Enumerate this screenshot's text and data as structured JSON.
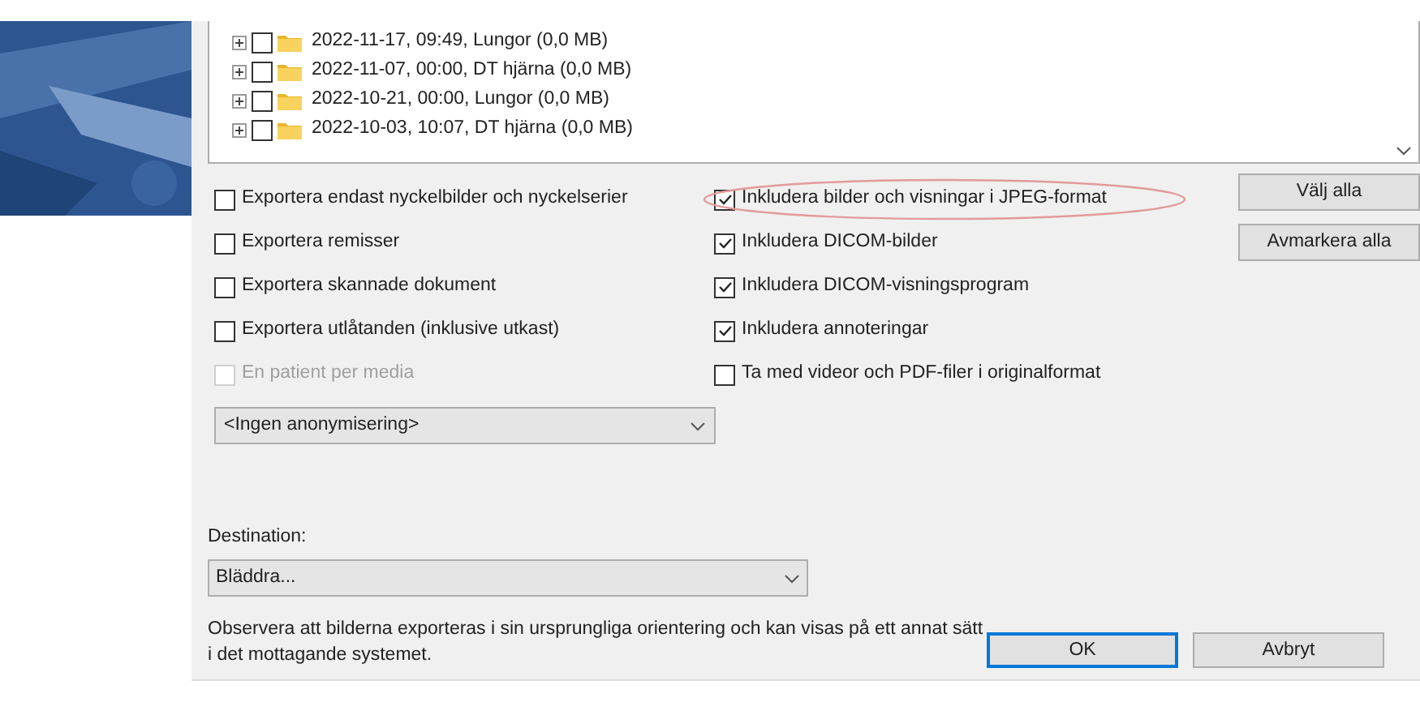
{
  "tree": {
    "rows": [
      {
        "label": "2022-11-17, 09:49, Lungor (0,0 MB)",
        "checked": false,
        "expanded": false
      },
      {
        "label": "2022-11-07, 00:00, DT hjärna (0,0 MB)",
        "checked": false,
        "expanded": false
      },
      {
        "label": "2022-10-21, 00:00, Lungor (0,0 MB)",
        "checked": false,
        "expanded": false
      },
      {
        "label": "2022-10-03, 10:07, DT hjärna (0,0 MB)",
        "checked": false,
        "expanded": false
      }
    ]
  },
  "left_options": [
    {
      "label": "Exportera endast nyckelbilder och nyckelserier",
      "checked": false,
      "disabled": false
    },
    {
      "label": "Exportera remisser",
      "checked": false,
      "disabled": false
    },
    {
      "label": "Exportera skannade dokument",
      "checked": false,
      "disabled": false
    },
    {
      "label": "Exportera utlåtanden (inklusive utkast)",
      "checked": false,
      "disabled": false
    },
    {
      "label": "En patient per media",
      "checked": false,
      "disabled": true
    }
  ],
  "right_options": [
    {
      "label": "Inkludera bilder och visningar i JPEG-format",
      "checked": true,
      "circled": true
    },
    {
      "label": "Inkludera DICOM-bilder",
      "checked": true,
      "circled": false
    },
    {
      "label": "Inkludera DICOM-visningsprogram",
      "checked": true,
      "circled": false
    },
    {
      "label": "Inkludera annoteringar",
      "checked": true,
      "circled": false
    },
    {
      "label": "Ta med videor och PDF-filer i originalformat",
      "checked": false,
      "circled": false
    }
  ],
  "side_buttons": [
    "Välj alla",
    "Avmarkera alla"
  ],
  "anonymization": {
    "value": "<Ingen anonymisering>"
  },
  "destination": {
    "label": "Destination:",
    "value": "Bläddra..."
  },
  "note": "Observera att bilderna exporteras i sin ursprungliga orientering och kan visas på ett annat sätt i det mottagande systemet.",
  "buttons": [
    {
      "label": "OK",
      "default": true
    },
    {
      "label": "Avbryt",
      "default": false
    }
  ]
}
